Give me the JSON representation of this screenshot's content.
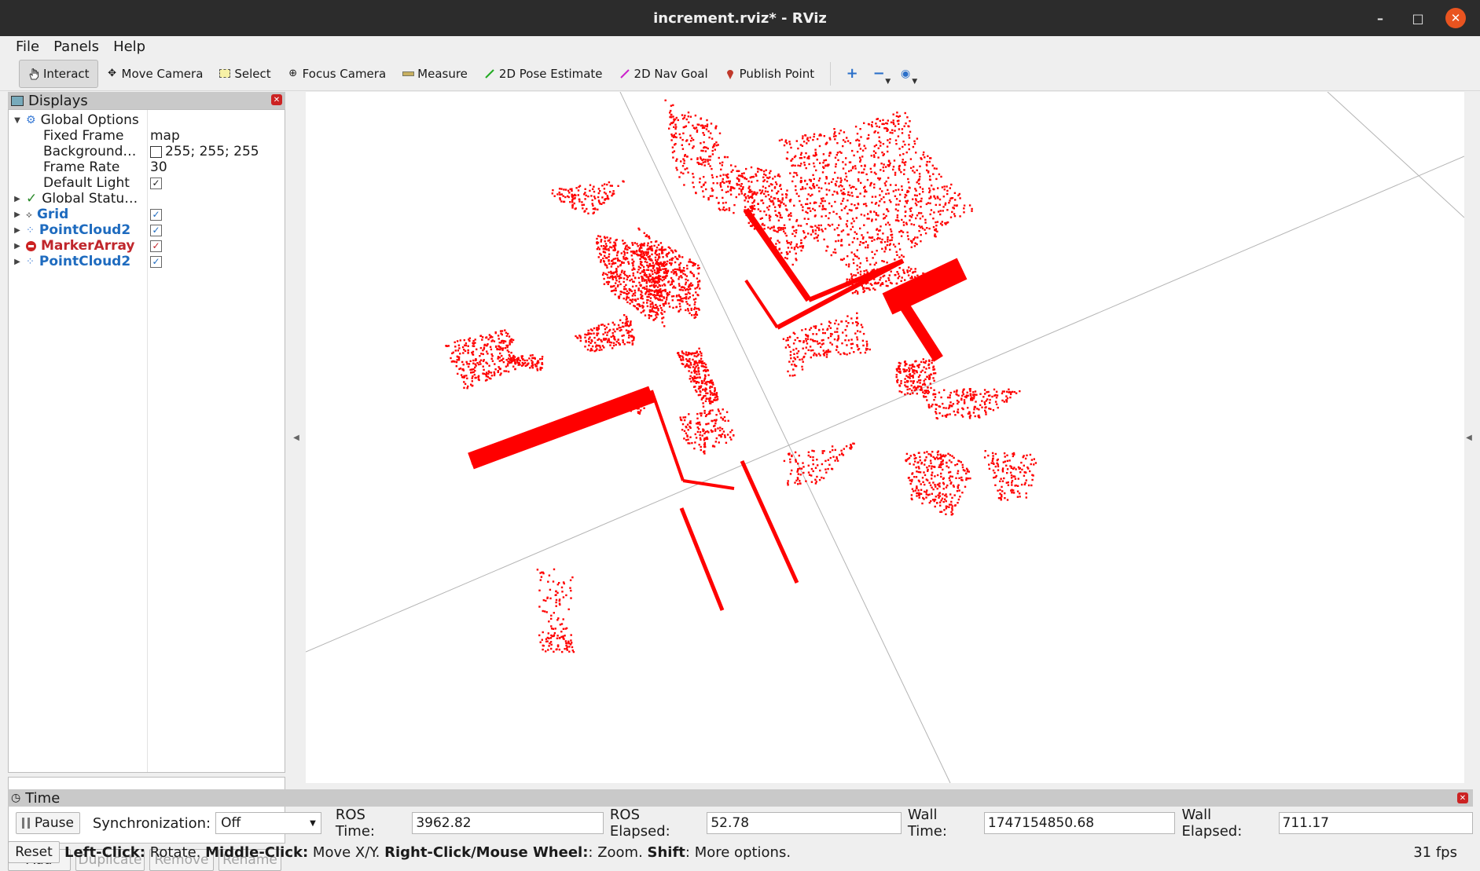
{
  "window": {
    "title": "increment.rviz* - RViz"
  },
  "menu": {
    "items": [
      "File",
      "Panels",
      "Help"
    ]
  },
  "toolbar": {
    "tools": [
      {
        "label": "Interact",
        "icon": "hand-icon"
      },
      {
        "label": "Move Camera",
        "icon": "move-icon"
      },
      {
        "label": "Select",
        "icon": "select-box-icon"
      },
      {
        "label": "Focus Camera",
        "icon": "focus-icon"
      },
      {
        "label": "Measure",
        "icon": "ruler-icon"
      },
      {
        "label": "2D Pose Estimate",
        "icon": "green-arrow-icon"
      },
      {
        "label": "2D Nav Goal",
        "icon": "magenta-arrow-icon"
      },
      {
        "label": "Publish Point",
        "icon": "pin-icon"
      }
    ],
    "active_tool": "Interact"
  },
  "displays": {
    "title": "Displays",
    "global_options": {
      "label": "Global Options",
      "fixed_frame_label": "Fixed Frame",
      "fixed_frame": "map",
      "background_label": "Background…",
      "background": "255; 255; 255",
      "frame_rate_label": "Frame Rate",
      "frame_rate": "30",
      "default_light_label": "Default Light"
    },
    "items": [
      {
        "label": "Global Statu…"
      },
      {
        "label": "Grid"
      },
      {
        "label": "PointCloud2"
      },
      {
        "label": "MarkerArray"
      },
      {
        "label": "PointCloud2"
      }
    ],
    "buttons": {
      "add": "Add",
      "duplicate": "Duplicate",
      "remove": "Remove",
      "rename": "Rename"
    }
  },
  "time": {
    "title": "Time",
    "pause": "Pause",
    "sync_label": "Synchronization:",
    "sync_value": "Off",
    "ros_time_label": "ROS Time:",
    "ros_time": "3962.82",
    "ros_elapsed_label": "ROS Elapsed:",
    "ros_elapsed": "52.78",
    "wall_time_label": "Wall Time:",
    "wall_time": "1747154850.68",
    "wall_elapsed_label": "Wall Elapsed:",
    "wall_elapsed": "711.17"
  },
  "status": {
    "reset": "Reset",
    "left_click": "Left-Click:",
    "left_click_desc": " Rotate. ",
    "middle_click": "Middle-Click:",
    "middle_click_desc": " Move X/Y. ",
    "right_click": "Right-Click/Mouse Wheel:",
    "right_click_desc": ": Zoom. ",
    "shift": "Shift",
    "shift_desc": ": More options.",
    "fps": "31 fps"
  },
  "colors": {
    "point_cloud": "#ff0000",
    "grid": "#b4b4b4",
    "background": "#ffffff"
  }
}
